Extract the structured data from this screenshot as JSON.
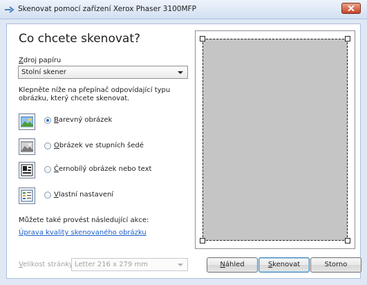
{
  "window": {
    "title": "Skenovat pomocí zařízení Xerox Phaser 3100MFP",
    "close_icon": "close-icon",
    "title_icon": "scanner-arrow-icon"
  },
  "heading": "Co chcete skenovat?",
  "source": {
    "label_mnemonic": "Z",
    "label_rest": "droj papíru",
    "selected": "Stolní skener"
  },
  "instructions": "Klepněte níže na přepínač odpovídající typu obrázku, který chcete skenovat.",
  "options": [
    {
      "mnemonic": "B",
      "rest": "arevný obrázek",
      "selected": true,
      "icon": "color-picture-icon"
    },
    {
      "mnemonic": "O",
      "rest": "brázek ve stupních šedé",
      "selected": false,
      "icon": "grayscale-picture-icon"
    },
    {
      "mnemonic": "Č",
      "rest": "ernobílý obrázek nebo text",
      "selected": false,
      "icon": "black-white-text-icon"
    },
    {
      "mnemonic": "V",
      "rest": "lastní nastavení",
      "selected": false,
      "icon": "custom-settings-icon"
    }
  ],
  "also_label": "Můžete také provést následující akce:",
  "adjust_link": "Úprava kvality skenovaného obrázku",
  "page_size": {
    "label_mnemonic": "V",
    "label_rest": "elikost stránky:",
    "selected": "Letter 216 x 279 mm"
  },
  "buttons": {
    "preview_mnemonic": "N",
    "preview_rest": "áhled",
    "scan_mnemonic": "S",
    "scan_rest": "kenovat",
    "cancel": "Storno"
  },
  "colors": {
    "link": "#1d5fc7",
    "scan_area": "#c5c5c5",
    "window_frame": "#dfe8f4"
  }
}
